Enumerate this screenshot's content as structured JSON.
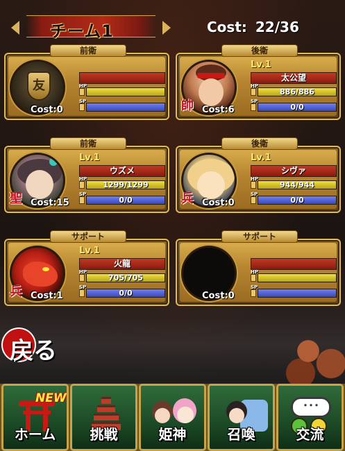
{
  "header": {
    "team_title": "チーム1",
    "cost_label": "Cost:",
    "cost_value": "22/36"
  },
  "slots": [
    {
      "position": "前衛",
      "level": "",
      "name": "",
      "hp": "",
      "sp": "",
      "cost": "Cost:0",
      "rank": "",
      "portrait": "shield-crest"
    },
    {
      "position": "後衛",
      "level": "Lv.1",
      "name": "太公望",
      "hp": "886/886",
      "sp": "0/0",
      "cost": "Cost:6",
      "rank": "帥",
      "portrait": "taikobo"
    },
    {
      "position": "前衛",
      "level": "Lv.1",
      "name": "ウズメ",
      "hp": "1299/1299",
      "sp": "0/0",
      "cost": "Cost:15",
      "rank": "聖",
      "portrait": "uzume"
    },
    {
      "position": "後衛",
      "level": "Lv.1",
      "name": "シヴァ",
      "hp": "944/944",
      "sp": "0/0",
      "cost": "Cost:0",
      "rank": "兵",
      "portrait": "shiva"
    },
    {
      "position": "サポート",
      "level": "Lv.1",
      "name": "火龍",
      "hp": "705/705",
      "sp": "0/0",
      "cost": "Cost:1",
      "rank": "兵",
      "portrait": "karyu"
    },
    {
      "position": "サポート",
      "level": "",
      "name": "",
      "hp": "",
      "sp": "",
      "cost": "Cost:0",
      "rank": "",
      "portrait": "empty"
    }
  ],
  "stat_tags": {
    "hp": "HP",
    "sp": "SP"
  },
  "shield_glyph": "友",
  "back_button": "戻る",
  "nav": {
    "new_badge": "NEW!",
    "items": [
      {
        "label": "ホーム",
        "icon": "torii-icon"
      },
      {
        "label": "挑戦",
        "icon": "pagoda-icon"
      },
      {
        "label": "姫神",
        "icon": "characters-icon"
      },
      {
        "label": "召喚",
        "icon": "summon-icon"
      },
      {
        "label": "交流",
        "icon": "chat-bubble-icon"
      }
    ],
    "bubble_text": "･･･"
  }
}
